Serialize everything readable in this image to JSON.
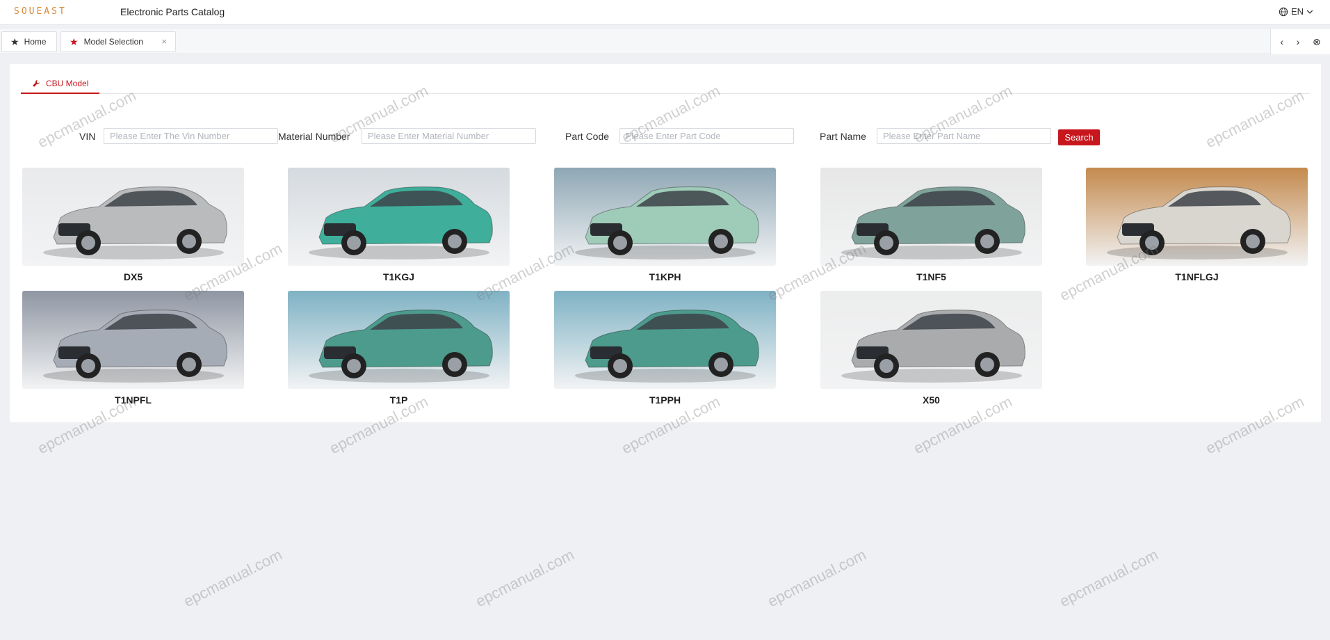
{
  "header": {
    "logo_text": "SOUEAST",
    "title": "Electronic Parts Catalog",
    "language": "EN"
  },
  "tabs": {
    "home_label": "Home",
    "model_label": "Model Selection",
    "close_glyph": "×"
  },
  "tab_nav": {
    "prev_glyph": "‹",
    "next_glyph": "›",
    "close_all_glyph": "⊗"
  },
  "subtab": {
    "label": "CBU Model",
    "icon": "wrench-icon"
  },
  "search": {
    "vin_label": "VIN",
    "vin_placeholder": "Please Enter The Vin Number",
    "material_label": "Material Number",
    "material_placeholder": "Please Enter Material Number",
    "part_code_label": "Part Code",
    "part_code_placeholder": "Please Enter Part Code",
    "part_name_label": "Part Name",
    "part_name_placeholder": "Please Enter Part Name",
    "button_label": "Search"
  },
  "models": [
    {
      "name": "DX5",
      "body": "#b9bbbd",
      "bg": "#e9eaec"
    },
    {
      "name": "T1KGJ",
      "body": "#3fae9a",
      "bg": "#d5dadf"
    },
    {
      "name": "T1KPH",
      "body": "#9fcbb9",
      "bg": "#8ea7b5"
    },
    {
      "name": "T1NF5",
      "body": "#7fa29a",
      "bg": "#e6e7e6"
    },
    {
      "name": "T1NFLGJ",
      "body": "#d9d6d0",
      "bg": "#c48a4e"
    },
    {
      "name": "T1NPFL",
      "body": "#a6acb6",
      "bg": "#8f96a3"
    },
    {
      "name": "T1P",
      "body": "#4c9b8c",
      "bg": "#7fb2c4"
    },
    {
      "name": "T1PPH",
      "body": "#4c9b8c",
      "bg": "#7fb2c4"
    },
    {
      "name": "X50",
      "body": "#a9abad",
      "bg": "#eceded"
    }
  ],
  "watermark": "epcmanual.com",
  "colors": {
    "accent": "#c8161d",
    "logo": "#d98a3a",
    "page_bg": "#eef0f3"
  }
}
